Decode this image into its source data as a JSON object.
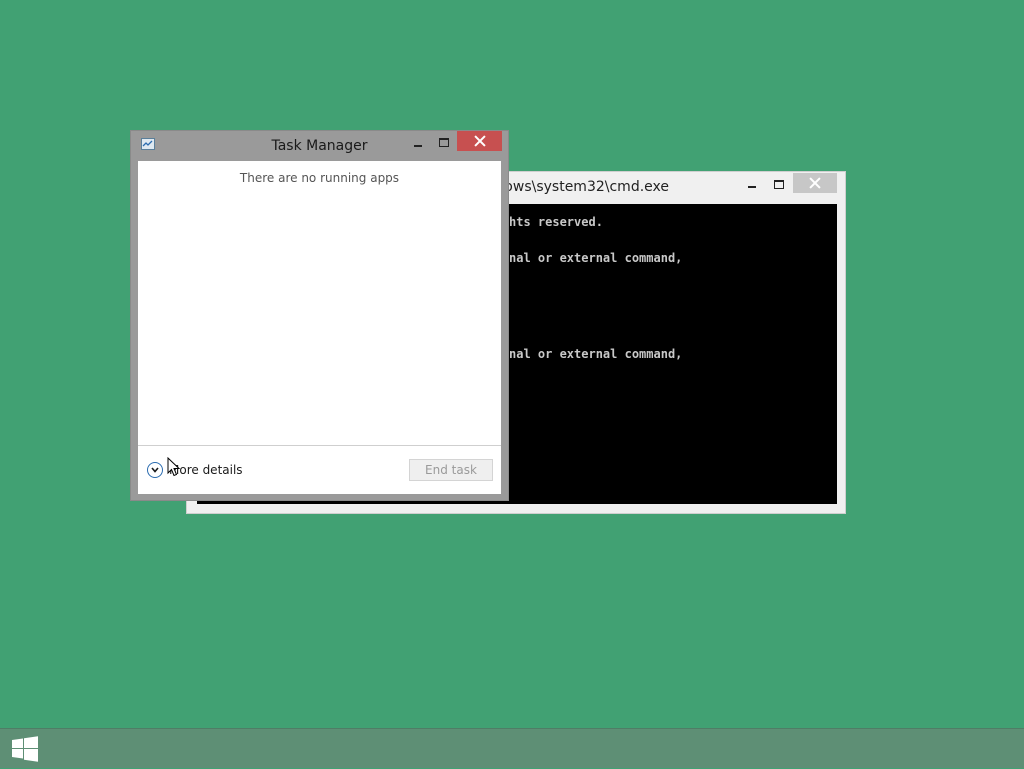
{
  "cmd_window": {
    "title": "C:\\Windows\\system32\\cmd.exe",
    "visible_title": "dows\\system32\\cmd.exe",
    "console_lines": [
      {
        "row": 0,
        "text": "hts reserved."
      },
      {
        "row": 2,
        "text": "nal or external command,"
      },
      {
        "row": 8,
        "text": "nal or external command,"
      }
    ]
  },
  "task_manager": {
    "title": "Task Manager",
    "empty_message": "There are no running apps",
    "more_details_label": "More details",
    "end_task_label": "End task",
    "end_task_enabled": false
  },
  "colors": {
    "desktop": "#41a173",
    "close_button": "#c75050",
    "taskbar": "#5e8f75"
  },
  "icons": {
    "start": "windows-logo-icon",
    "more_details": "chevron-down-icon",
    "task_manager_app": "task-manager-icon"
  }
}
